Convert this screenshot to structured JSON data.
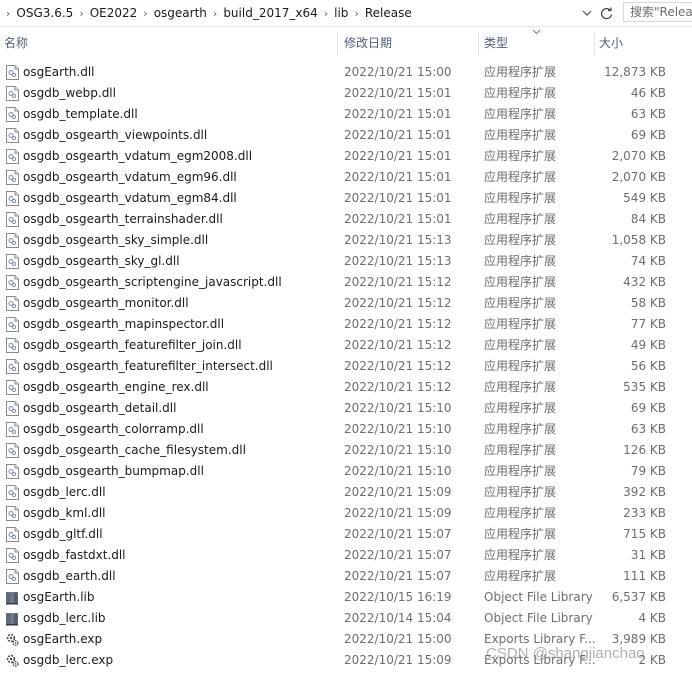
{
  "address_bar": {
    "crumbs": [
      "OSG3.6.5",
      "OE2022",
      "osgearth",
      "build_2017_x64",
      "lib",
      "Release"
    ],
    "search_placeholder": "搜索\"Release\""
  },
  "columns": {
    "name": "名称",
    "date": "修改日期",
    "type": "类型",
    "size": "大小"
  },
  "files": [
    {
      "name": "osgEarth.dll",
      "date": "2022/10/21 15:00",
      "type": "应用程序扩展",
      "size": "12,873 KB",
      "icon": "dll-file-icon"
    },
    {
      "name": "osgdb_webp.dll",
      "date": "2022/10/21 15:01",
      "type": "应用程序扩展",
      "size": "46 KB",
      "icon": "dll-file-icon"
    },
    {
      "name": "osgdb_template.dll",
      "date": "2022/10/21 15:01",
      "type": "应用程序扩展",
      "size": "63 KB",
      "icon": "dll-file-icon"
    },
    {
      "name": "osgdb_osgearth_viewpoints.dll",
      "date": "2022/10/21 15:01",
      "type": "应用程序扩展",
      "size": "69 KB",
      "icon": "dll-file-icon"
    },
    {
      "name": "osgdb_osgearth_vdatum_egm2008.dll",
      "date": "2022/10/21 15:01",
      "type": "应用程序扩展",
      "size": "2,070 KB",
      "icon": "dll-file-icon"
    },
    {
      "name": "osgdb_osgearth_vdatum_egm96.dll",
      "date": "2022/10/21 15:01",
      "type": "应用程序扩展",
      "size": "2,070 KB",
      "icon": "dll-file-icon"
    },
    {
      "name": "osgdb_osgearth_vdatum_egm84.dll",
      "date": "2022/10/21 15:01",
      "type": "应用程序扩展",
      "size": "549 KB",
      "icon": "dll-file-icon"
    },
    {
      "name": "osgdb_osgearth_terrainshader.dll",
      "date": "2022/10/21 15:01",
      "type": "应用程序扩展",
      "size": "84 KB",
      "icon": "dll-file-icon"
    },
    {
      "name": "osgdb_osgearth_sky_simple.dll",
      "date": "2022/10/21 15:13",
      "type": "应用程序扩展",
      "size": "1,058 KB",
      "icon": "dll-file-icon"
    },
    {
      "name": "osgdb_osgearth_sky_gl.dll",
      "date": "2022/10/21 15:13",
      "type": "应用程序扩展",
      "size": "74 KB",
      "icon": "dll-file-icon"
    },
    {
      "name": "osgdb_osgearth_scriptengine_javascript.dll",
      "date": "2022/10/21 15:12",
      "type": "应用程序扩展",
      "size": "432 KB",
      "icon": "dll-file-icon"
    },
    {
      "name": "osgdb_osgearth_monitor.dll",
      "date": "2022/10/21 15:12",
      "type": "应用程序扩展",
      "size": "58 KB",
      "icon": "dll-file-icon"
    },
    {
      "name": "osgdb_osgearth_mapinspector.dll",
      "date": "2022/10/21 15:12",
      "type": "应用程序扩展",
      "size": "77 KB",
      "icon": "dll-file-icon"
    },
    {
      "name": "osgdb_osgearth_featurefilter_join.dll",
      "date": "2022/10/21 15:12",
      "type": "应用程序扩展",
      "size": "49 KB",
      "icon": "dll-file-icon"
    },
    {
      "name": "osgdb_osgearth_featurefilter_intersect.dll",
      "date": "2022/10/21 15:12",
      "type": "应用程序扩展",
      "size": "56 KB",
      "icon": "dll-file-icon"
    },
    {
      "name": "osgdb_osgearth_engine_rex.dll",
      "date": "2022/10/21 15:12",
      "type": "应用程序扩展",
      "size": "535 KB",
      "icon": "dll-file-icon"
    },
    {
      "name": "osgdb_osgearth_detail.dll",
      "date": "2022/10/21 15:10",
      "type": "应用程序扩展",
      "size": "69 KB",
      "icon": "dll-file-icon"
    },
    {
      "name": "osgdb_osgearth_colorramp.dll",
      "date": "2022/10/21 15:10",
      "type": "应用程序扩展",
      "size": "63 KB",
      "icon": "dll-file-icon"
    },
    {
      "name": "osgdb_osgearth_cache_filesystem.dll",
      "date": "2022/10/21 15:10",
      "type": "应用程序扩展",
      "size": "126 KB",
      "icon": "dll-file-icon"
    },
    {
      "name": "osgdb_osgearth_bumpmap.dll",
      "date": "2022/10/21 15:10",
      "type": "应用程序扩展",
      "size": "79 KB",
      "icon": "dll-file-icon"
    },
    {
      "name": "osgdb_lerc.dll",
      "date": "2022/10/21 15:09",
      "type": "应用程序扩展",
      "size": "392 KB",
      "icon": "dll-file-icon"
    },
    {
      "name": "osgdb_kml.dll",
      "date": "2022/10/21 15:09",
      "type": "应用程序扩展",
      "size": "233 KB",
      "icon": "dll-file-icon"
    },
    {
      "name": "osgdb_gltf.dll",
      "date": "2022/10/21 15:07",
      "type": "应用程序扩展",
      "size": "715 KB",
      "icon": "dll-file-icon"
    },
    {
      "name": "osgdb_fastdxt.dll",
      "date": "2022/10/21 15:07",
      "type": "应用程序扩展",
      "size": "31 KB",
      "icon": "dll-file-icon"
    },
    {
      "name": "osgdb_earth.dll",
      "date": "2022/10/21 15:07",
      "type": "应用程序扩展",
      "size": "111 KB",
      "icon": "dll-file-icon"
    },
    {
      "name": "osgEarth.lib",
      "date": "2022/10/15 16:19",
      "type": "Object File Library",
      "size": "6,537 KB",
      "icon": "lib-file-icon"
    },
    {
      "name": "osgdb_lerc.lib",
      "date": "2022/10/14 15:04",
      "type": "Object File Library",
      "size": "4 KB",
      "icon": "lib-file-icon"
    },
    {
      "name": "osgEarth.exp",
      "date": "2022/10/21 15:00",
      "type": "Exports Library F...",
      "size": "3,989 KB",
      "icon": "exp-file-icon"
    },
    {
      "name": "osgdb_lerc.exp",
      "date": "2022/10/21 15:09",
      "type": "Exports Library F...",
      "size": "2 KB",
      "icon": "exp-file-icon"
    }
  ],
  "watermark": "CSDN @shangjianchao"
}
